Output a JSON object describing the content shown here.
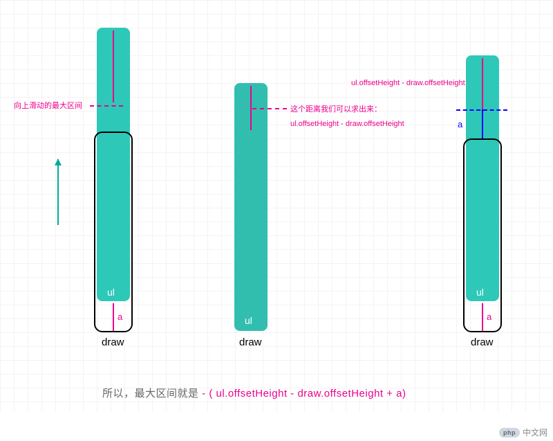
{
  "labels": {
    "ul": "ul",
    "a_pink": "a",
    "a_blue": "a",
    "draw": "draw"
  },
  "fig1": {
    "annotation": "向上滑动的最大区间"
  },
  "fig2": {
    "annotation_line1": "这个距离我们可以求出来：",
    "annotation_line2": "ul.offsetHeight - draw.offsetHeight"
  },
  "fig3": {
    "annotation": "ul.offsetHeight - draw.offsetHeight"
  },
  "conclusion": {
    "prefix": "所以，最大区间就是 ",
    "formula": "- ( ul.offsetHeight - draw.offsetHeight + a)"
  },
  "watermark": {
    "badge": "php",
    "text": "中文网"
  },
  "chart_data": {
    "type": "diagram",
    "title": "Maximum upward swipe range derivation",
    "elements": [
      {
        "id": "figure1",
        "description": "draw viewport with ul overflowing above; inside draw, ul occupies upper portion and gap 'a' at bottom is marked; annotation: max upward swipe range (向上滑动的最大区间) indicated at top overflow; green arrow shows upward swipe direction"
      },
      {
        "id": "figure2",
        "description": "draw viewport with ul overflowing above (less than fig1); annotation indicates the overflow height equals ul.offsetHeight - draw.offsetHeight"
      },
      {
        "id": "figure3",
        "description": "draw viewport with ul overflowing above even more; blue segment labeled 'a' just above draw top; above it pink annotation ul.offsetHeight - draw.offsetHeight; dashed line separates the two; ul fills top of draw and gap 'a' at bottom"
      }
    ],
    "formula": "max_range = -(ul.offsetHeight - draw.offsetHeight + a)",
    "legend": {
      "ul": "the scrolling content element (teal filled rounded rect)",
      "draw": "the viewport container (black outlined rounded rect)",
      "a": "the gap below ul inside draw"
    }
  }
}
